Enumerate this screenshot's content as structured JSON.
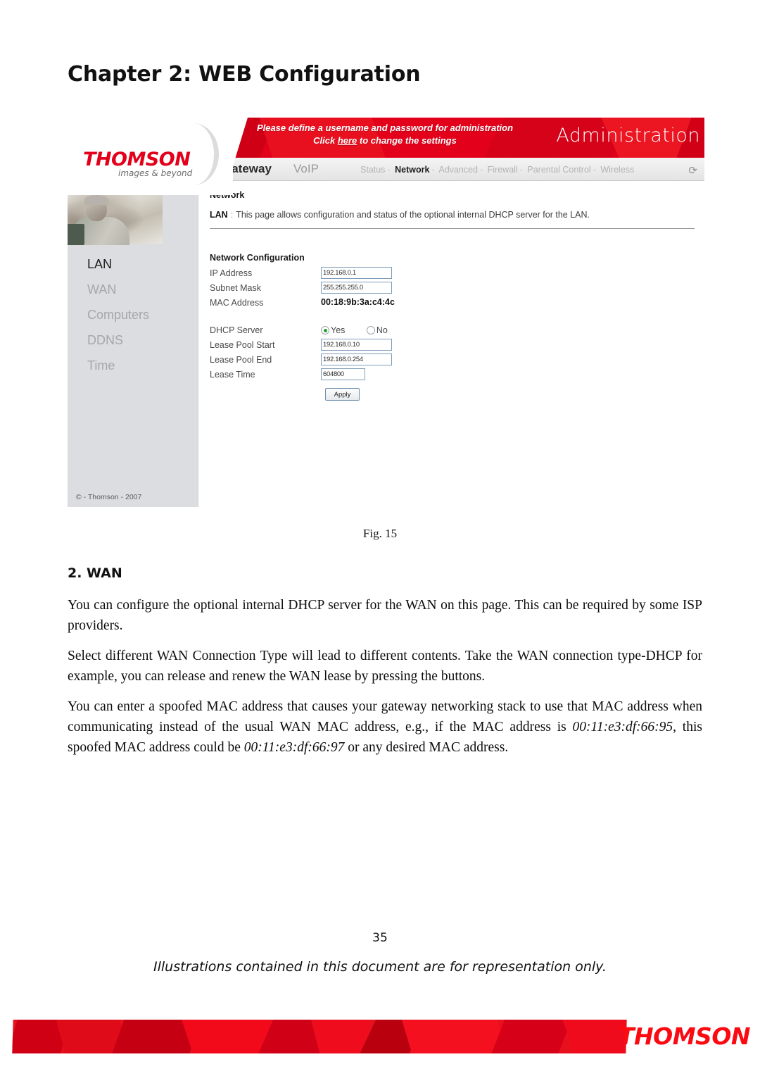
{
  "document": {
    "chapter_title": "Chapter 2: WEB Configuration",
    "figure_caption": "Fig. 15",
    "section_heading": "2. WAN",
    "paragraph_1": "You can configure the optional internal DHCP server for the WAN on this page. This can be required by some ISP providers.",
    "paragraph_2": "Select different WAN Connection Type will lead to different contents. Take the WAN connection type-DHCP for example, you can release and renew the WAN lease by pressing the buttons.",
    "paragraph_3_part1": "You can enter a spoofed MAC address that causes your gateway networking stack to use that MAC address when communicating instead of the usual WAN MAC address, e.g., if the MAC address is ",
    "paragraph_3_mac1": "00:11:e3:df:66:95",
    "paragraph_3_part2": ", this spoofed MAC address could be ",
    "paragraph_3_mac2": "00:11:e3:df:66:97",
    "paragraph_3_part3": " or any desired MAC address.",
    "page_number": "35",
    "disclaimer": "Illustrations contained in this document are for representation only."
  },
  "footer_band": {
    "brand": "THOMSON",
    "brand_color": "#fb0a12"
  },
  "router_ui": {
    "brand": {
      "logo_text": "THOMSON",
      "tagline": "images & beyond",
      "logo_color": "#e2001a"
    },
    "banner": {
      "message_line1": "Please define a username and password for administration",
      "message_line2_before": "Click ",
      "message_line2_link": "here",
      "message_line2_after": " to change the settings",
      "title": "Administration",
      "background_color": "#e2001a"
    },
    "menubar": {
      "primary": [
        "Gateway",
        "VoIP"
      ],
      "subnav": [
        "Status",
        "Network",
        "Advanced",
        "Firewall",
        "Parental Control",
        "Wireless"
      ],
      "active_subnav": "Network",
      "separator": "-",
      "refresh_icon": "refresh-icon"
    },
    "sidebar": {
      "items": [
        {
          "label": "LAN",
          "active": true
        },
        {
          "label": "WAN",
          "active": false
        },
        {
          "label": "Computers",
          "active": false
        },
        {
          "label": "DDNS",
          "active": false
        },
        {
          "label": "Time",
          "active": false
        }
      ],
      "copyright": "© - Thomson - 2007"
    },
    "content": {
      "section_title": "Network",
      "page_label": "LAN",
      "page_description": "This page allows configuration and status of the optional internal DHCP server for the LAN.",
      "form_title": "Network Configuration",
      "fields": {
        "ip_address_label": "IP Address",
        "ip_address_value": "192.168.0.1",
        "subnet_mask_label": "Subnet Mask",
        "subnet_mask_value": "255.255.255.0",
        "mac_address_label": "MAC Address",
        "mac_address_value": "00:18:9b:3a:c4:4c",
        "dhcp_server_label": "DHCP Server",
        "dhcp_yes_label": "Yes",
        "dhcp_no_label": "No",
        "dhcp_selected": "Yes",
        "lease_pool_start_label": "Lease Pool Start",
        "lease_pool_start_value": "192.168.0.10",
        "lease_pool_end_label": "Lease Pool End",
        "lease_pool_end_value": "192.168.0.254",
        "lease_time_label": "Lease Time",
        "lease_time_value": "604800"
      },
      "apply_button": "Apply"
    }
  }
}
